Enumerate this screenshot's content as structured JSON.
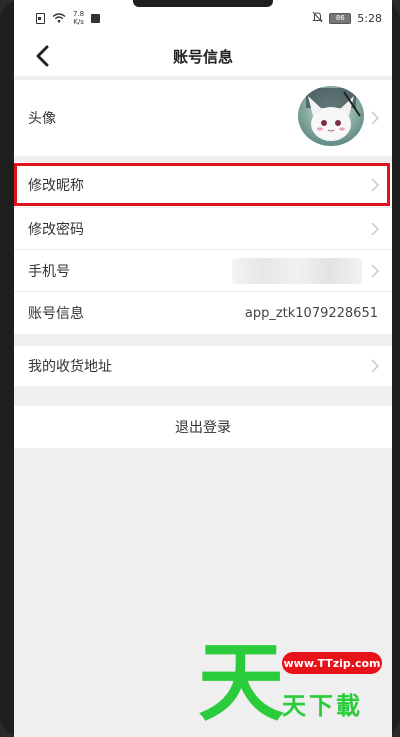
{
  "status_bar": {
    "net_speed_value": "7.8",
    "net_speed_unit": "K/s",
    "battery": "86",
    "time": "5:28"
  },
  "header": {
    "title": "账号信息",
    "back_icon": "chevron-left-icon"
  },
  "profile_group": {
    "avatar_label": "头像",
    "rows": [
      {
        "label": "修改昵称",
        "value": ""
      },
      {
        "label": "修改密码",
        "value": ""
      },
      {
        "label": "手机号",
        "value": ""
      },
      {
        "label": "账号信息",
        "value": "app_ztk1079228651"
      }
    ]
  },
  "address_group": {
    "label": "我的收货地址"
  },
  "logout": {
    "label": "退出登录"
  },
  "watermark": {
    "big_char": "天",
    "url": "www.TTzip.com",
    "text": "天下載"
  },
  "colors": {
    "highlight_border": "#e0121b",
    "watermark_green": "#2bcc3b",
    "watermark_red": "#e8121b"
  }
}
